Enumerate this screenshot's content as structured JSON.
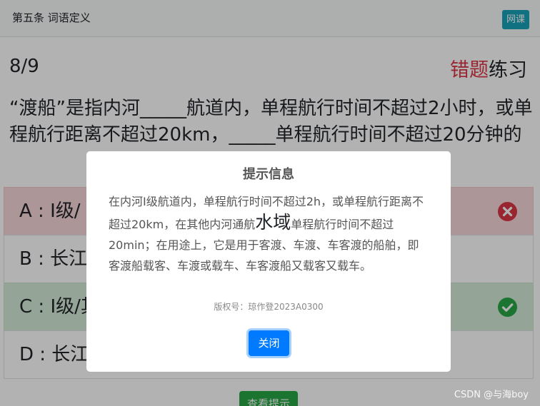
{
  "header": {
    "title": "第五条 词语定义",
    "course_button": "网课"
  },
  "progress": "8/9",
  "mode": {
    "wrong": "错题",
    "practice": "练习"
  },
  "question": "“渡船”是指内河_____航道内，单程航行时间不超过2小时，或单程航行距离不超过20km，_____单程航行时间不超过20分钟的",
  "options": [
    {
      "label": "A : Ⅰ级/ Ⅰ",
      "state": "wrong",
      "state_icon": "x-circle-icon"
    },
    {
      "label": "B : 长江/",
      "state": "normal"
    },
    {
      "label": "C : Ⅰ级/其",
      "state": "correct",
      "state_icon": "check-circle-icon"
    },
    {
      "label": "D : 长江",
      "state": "normal"
    }
  ],
  "hint_button": "查看提示",
  "modal": {
    "title": "提示信息",
    "body_part1": "在内河Ⅰ级航道内，单程航行时间不超过2h，或单程航行距离不超过20km，在其他内河通航",
    "body_emphasis": "水域",
    "body_part2": "单程航行时间不超过20min；在用途上，它是用于客渡、车渡、车客渡的船舶，即客渡船载客、车渡或载车、车客渡船又载客又载车。",
    "copyright": "版权号：琼作登2023A0300",
    "close_button": "关闭"
  },
  "watermark": "CSDN @与海boy",
  "colors": {
    "wrong_icon": "#dc3545",
    "correct_icon": "#28a745",
    "primary": "#007bff",
    "info": "#17a2b8"
  }
}
